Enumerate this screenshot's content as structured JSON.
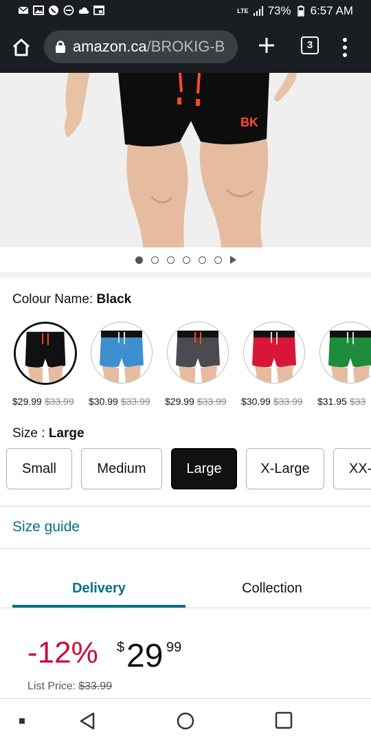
{
  "status_bar": {
    "battery_percent": "73%",
    "time": "6:57 AM",
    "network": "LTE"
  },
  "browser": {
    "url_host": "amazon.ca",
    "url_path": "/BROKIG-B",
    "tab_count": "3"
  },
  "gallery": {
    "image_count": 6,
    "active_index": 0
  },
  "colour": {
    "label": "Colour Name:",
    "selected": "Black",
    "options": [
      {
        "name": "black-shorts",
        "price": "$29.99",
        "list_price": "$33.99",
        "color": "#111111"
      },
      {
        "name": "blue-shorts",
        "price": "$30.99",
        "list_price": "$33.99",
        "color": "#3d8fd0"
      },
      {
        "name": "grey-shorts",
        "price": "$29.99",
        "list_price": "$33.99",
        "color": "#4a4a50"
      },
      {
        "name": "red-shorts",
        "price": "$30.99",
        "list_price": "$33.99",
        "color": "#d8163a"
      },
      {
        "name": "green-shorts",
        "price": "$31.95",
        "list_price": "$33",
        "color": "#1e8c3a"
      }
    ]
  },
  "size": {
    "label": "Size :",
    "selected": "Large",
    "options": [
      "Small",
      "Medium",
      "Large",
      "X-Large",
      "XX-"
    ]
  },
  "size_guide": "Size guide",
  "tabs": [
    "Delivery",
    "Collection"
  ],
  "pricing": {
    "discount": "-12%",
    "currency": "$",
    "whole": "29",
    "fraction": "99",
    "list_price_label": "List Price:",
    "list_price": "$33.99"
  },
  "colors": {
    "accent_teal": "#007185",
    "discount_red": "#cc0c39",
    "brand_logo": "#ff4a2a"
  }
}
